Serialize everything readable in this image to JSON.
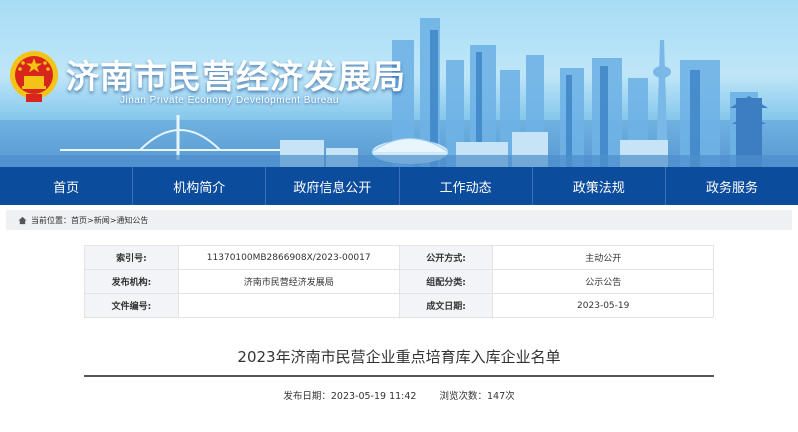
{
  "header": {
    "site_title": "济南市民营经济发展局",
    "site_subtitle": "Jinan Private Economy Development Bureau"
  },
  "nav": {
    "items": [
      {
        "label": "首页"
      },
      {
        "label": "机构简介"
      },
      {
        "label": "政府信息公开"
      },
      {
        "label": "工作动态"
      },
      {
        "label": "政策法规"
      },
      {
        "label": "政务服务"
      }
    ]
  },
  "breadcrumb": {
    "prefix": "当前位置：",
    "items": [
      "首页",
      "新闻",
      "通知公告"
    ],
    "separator": ">"
  },
  "meta": {
    "index_label": "索引号:",
    "index_value": "11370100MB2866908X/2023-00017",
    "disclosure_label": "公开方式:",
    "disclosure_value": "主动公开",
    "publisher_label": "发布机构:",
    "publisher_value": "济南市民营经济发展局",
    "category_label": "组配分类:",
    "category_value": "公示公告",
    "doc_no_label": "文件编号:",
    "doc_no_value": "",
    "date_label": "成文日期:",
    "date_value": "2023-05-19"
  },
  "article": {
    "title": "2023年济南市民营企业重点培育库入库企业名单",
    "publish_label": "发布日期：",
    "publish_value": "2023-05-19 11:42",
    "views_label": "浏览次数：",
    "views_value": "147次"
  },
  "colors": {
    "nav_bg": "#0c4c9c",
    "banner_sky": "#a7dcf6",
    "breadcrumb_bg": "#eef0f3",
    "emblem_red": "#d9261c",
    "emblem_gold": "#f3c316"
  },
  "icons": {
    "emblem": "national-emblem",
    "home": "home-icon"
  }
}
